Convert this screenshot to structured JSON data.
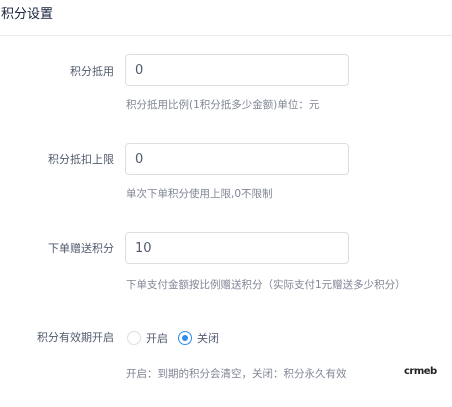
{
  "header": {
    "title": "积分设置"
  },
  "form": {
    "integral_deduction": {
      "label": "积分抵用",
      "value": "0",
      "help": "积分抵用比例(1积分抵多少金额)单位：元"
    },
    "deduction_limit": {
      "label": "积分抵扣上限",
      "value": "0",
      "help": "单次下单积分使用上限,0不限制"
    },
    "order_gift": {
      "label": "下单赠送积分",
      "value": "10",
      "help": "下单支付金额按比例赠送积分（实际支付1元赠送多少积分）"
    },
    "expiry": {
      "label": "积分有效期开启",
      "options": [
        {
          "label": "开启",
          "checked": false
        },
        {
          "label": "关闭",
          "checked": true
        }
      ],
      "help": "开启：到期的积分会清空，关闭：积分永久有效"
    }
  },
  "watermark": {
    "text": "crmeb"
  }
}
